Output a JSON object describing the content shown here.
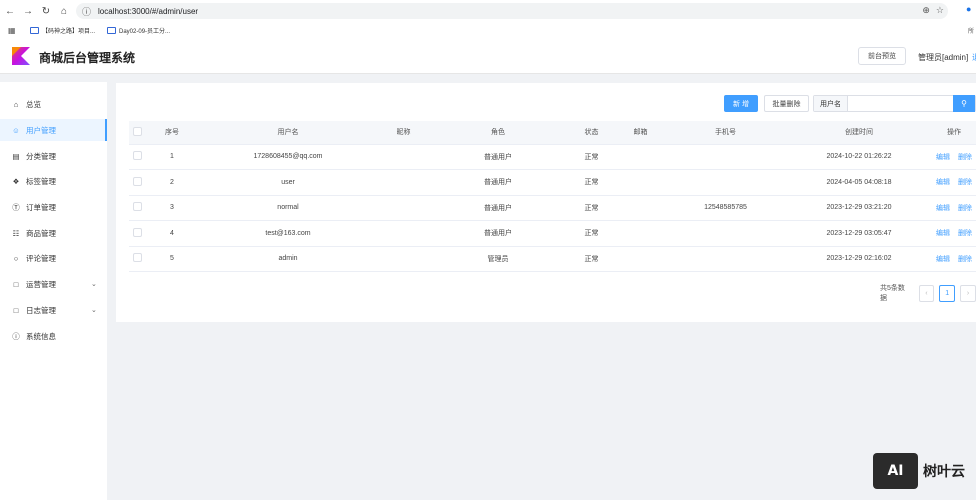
{
  "browser": {
    "url": "localhost:3000/#/admin/user",
    "bookmarks": [
      "【码神之路】项目...",
      "Day02-09-员工分..."
    ],
    "bookmark_overflow": "所"
  },
  "header": {
    "title": "商城后台管理系统",
    "preview_button": "前台预览",
    "admin_label": "管理员[admin]",
    "admin_extra": "退"
  },
  "sidebar": {
    "items": [
      {
        "label": "总览",
        "icon": "home-icon"
      },
      {
        "label": "用户管理",
        "icon": "user-icon",
        "active": true
      },
      {
        "label": "分类管理",
        "icon": "category-icon"
      },
      {
        "label": "标签管理",
        "icon": "tag-icon"
      },
      {
        "label": "订单管理",
        "icon": "order-icon"
      },
      {
        "label": "商品管理",
        "icon": "goods-icon"
      },
      {
        "label": "评论管理",
        "icon": "comment-icon"
      },
      {
        "label": "运营管理",
        "icon": "folder-icon",
        "expandable": true
      },
      {
        "label": "日志管理",
        "icon": "folder-icon",
        "expandable": true
      },
      {
        "label": "系统信息",
        "icon": "info-icon"
      }
    ]
  },
  "toolbar": {
    "add_label": "新 增",
    "batch_delete_label": "批量删除",
    "search_prefix": "用户名",
    "search_placeholder": ""
  },
  "table": {
    "headers": [
      "序号",
      "用户名",
      "昵称",
      "角色",
      "状态",
      "邮箱",
      "手机号",
      "创建时间",
      "操作"
    ],
    "rows": [
      {
        "index": "1",
        "username": "1728608455@qq.com",
        "nickname": "",
        "role": "普通用户",
        "status": "正常",
        "email": "",
        "phone": "",
        "created": "2024-10-22 01:26:22"
      },
      {
        "index": "2",
        "username": "user",
        "nickname": "",
        "role": "普通用户",
        "status": "正常",
        "email": "",
        "phone": "",
        "created": "2024-04-05 04:08:18"
      },
      {
        "index": "3",
        "username": "normal",
        "nickname": "",
        "role": "普通用户",
        "status": "正常",
        "email": "",
        "phone": "12548585785",
        "created": "2023-12-29 03:21:20"
      },
      {
        "index": "4",
        "username": "test@163.com",
        "nickname": "",
        "role": "普通用户",
        "status": "正常",
        "email": "",
        "phone": "",
        "created": "2023-12-29 03:05:47"
      },
      {
        "index": "5",
        "username": "admin",
        "nickname": "",
        "role": "管理员",
        "status": "正常",
        "email": "",
        "phone": "",
        "created": "2023-12-29 02:16:02"
      }
    ],
    "edit_label": "编辑",
    "delete_label": "删除"
  },
  "pagination": {
    "total_text": "共5条数据",
    "current_page": "1"
  },
  "watermark": {
    "logo_text": "AI",
    "text": "树叶云"
  },
  "colors": {
    "primary": "#409eff",
    "background": "#f0f2f5"
  }
}
